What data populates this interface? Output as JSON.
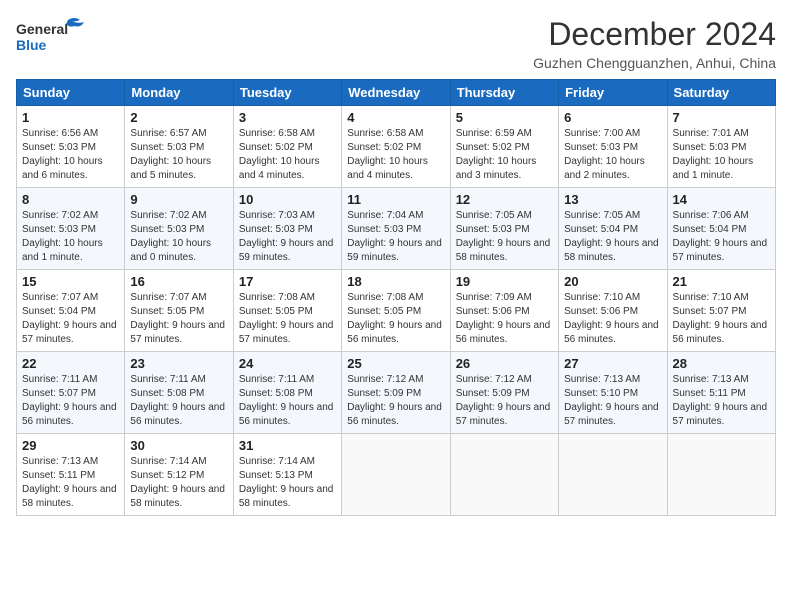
{
  "header": {
    "logo_line1": "General",
    "logo_line2": "Blue",
    "month": "December 2024",
    "location": "Guzhen Chengguanzhen, Anhui, China"
  },
  "weekdays": [
    "Sunday",
    "Monday",
    "Tuesday",
    "Wednesday",
    "Thursday",
    "Friday",
    "Saturday"
  ],
  "weeks": [
    [
      {
        "day": "1",
        "sunrise": "6:56 AM",
        "sunset": "5:03 PM",
        "daylight": "10 hours and 6 minutes."
      },
      {
        "day": "2",
        "sunrise": "6:57 AM",
        "sunset": "5:03 PM",
        "daylight": "10 hours and 5 minutes."
      },
      {
        "day": "3",
        "sunrise": "6:58 AM",
        "sunset": "5:02 PM",
        "daylight": "10 hours and 4 minutes."
      },
      {
        "day": "4",
        "sunrise": "6:58 AM",
        "sunset": "5:02 PM",
        "daylight": "10 hours and 4 minutes."
      },
      {
        "day": "5",
        "sunrise": "6:59 AM",
        "sunset": "5:02 PM",
        "daylight": "10 hours and 3 minutes."
      },
      {
        "day": "6",
        "sunrise": "7:00 AM",
        "sunset": "5:03 PM",
        "daylight": "10 hours and 2 minutes."
      },
      {
        "day": "7",
        "sunrise": "7:01 AM",
        "sunset": "5:03 PM",
        "daylight": "10 hours and 1 minute."
      }
    ],
    [
      {
        "day": "8",
        "sunrise": "7:02 AM",
        "sunset": "5:03 PM",
        "daylight": "10 hours and 1 minute."
      },
      {
        "day": "9",
        "sunrise": "7:02 AM",
        "sunset": "5:03 PM",
        "daylight": "10 hours and 0 minutes."
      },
      {
        "day": "10",
        "sunrise": "7:03 AM",
        "sunset": "5:03 PM",
        "daylight": "9 hours and 59 minutes."
      },
      {
        "day": "11",
        "sunrise": "7:04 AM",
        "sunset": "5:03 PM",
        "daylight": "9 hours and 59 minutes."
      },
      {
        "day": "12",
        "sunrise": "7:05 AM",
        "sunset": "5:03 PM",
        "daylight": "9 hours and 58 minutes."
      },
      {
        "day": "13",
        "sunrise": "7:05 AM",
        "sunset": "5:04 PM",
        "daylight": "9 hours and 58 minutes."
      },
      {
        "day": "14",
        "sunrise": "7:06 AM",
        "sunset": "5:04 PM",
        "daylight": "9 hours and 57 minutes."
      }
    ],
    [
      {
        "day": "15",
        "sunrise": "7:07 AM",
        "sunset": "5:04 PM",
        "daylight": "9 hours and 57 minutes."
      },
      {
        "day": "16",
        "sunrise": "7:07 AM",
        "sunset": "5:05 PM",
        "daylight": "9 hours and 57 minutes."
      },
      {
        "day": "17",
        "sunrise": "7:08 AM",
        "sunset": "5:05 PM",
        "daylight": "9 hours and 57 minutes."
      },
      {
        "day": "18",
        "sunrise": "7:08 AM",
        "sunset": "5:05 PM",
        "daylight": "9 hours and 56 minutes."
      },
      {
        "day": "19",
        "sunrise": "7:09 AM",
        "sunset": "5:06 PM",
        "daylight": "9 hours and 56 minutes."
      },
      {
        "day": "20",
        "sunrise": "7:10 AM",
        "sunset": "5:06 PM",
        "daylight": "9 hours and 56 minutes."
      },
      {
        "day": "21",
        "sunrise": "7:10 AM",
        "sunset": "5:07 PM",
        "daylight": "9 hours and 56 minutes."
      }
    ],
    [
      {
        "day": "22",
        "sunrise": "7:11 AM",
        "sunset": "5:07 PM",
        "daylight": "9 hours and 56 minutes."
      },
      {
        "day": "23",
        "sunrise": "7:11 AM",
        "sunset": "5:08 PM",
        "daylight": "9 hours and 56 minutes."
      },
      {
        "day": "24",
        "sunrise": "7:11 AM",
        "sunset": "5:08 PM",
        "daylight": "9 hours and 56 minutes."
      },
      {
        "day": "25",
        "sunrise": "7:12 AM",
        "sunset": "5:09 PM",
        "daylight": "9 hours and 56 minutes."
      },
      {
        "day": "26",
        "sunrise": "7:12 AM",
        "sunset": "5:09 PM",
        "daylight": "9 hours and 57 minutes."
      },
      {
        "day": "27",
        "sunrise": "7:13 AM",
        "sunset": "5:10 PM",
        "daylight": "9 hours and 57 minutes."
      },
      {
        "day": "28",
        "sunrise": "7:13 AM",
        "sunset": "5:11 PM",
        "daylight": "9 hours and 57 minutes."
      }
    ],
    [
      {
        "day": "29",
        "sunrise": "7:13 AM",
        "sunset": "5:11 PM",
        "daylight": "9 hours and 58 minutes."
      },
      {
        "day": "30",
        "sunrise": "7:14 AM",
        "sunset": "5:12 PM",
        "daylight": "9 hours and 58 minutes."
      },
      {
        "day": "31",
        "sunrise": "7:14 AM",
        "sunset": "5:13 PM",
        "daylight": "9 hours and 58 minutes."
      },
      null,
      null,
      null,
      null
    ]
  ],
  "labels": {
    "sunrise": "Sunrise:",
    "sunset": "Sunset:",
    "daylight": "Daylight:"
  }
}
